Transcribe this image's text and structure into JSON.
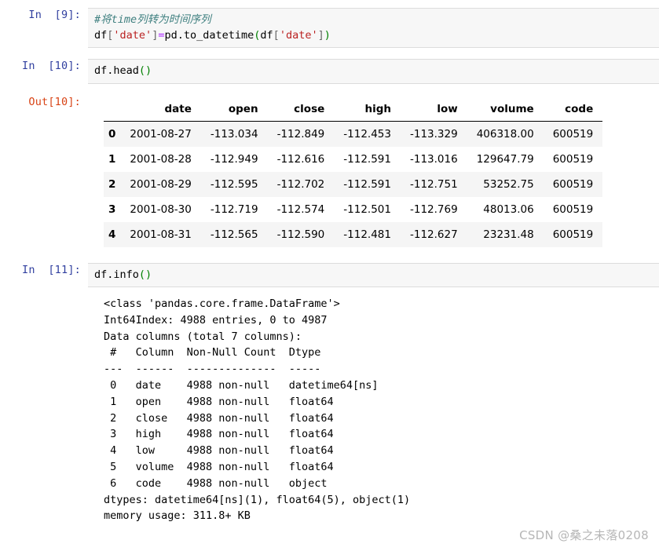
{
  "notebook": {
    "cells": [
      {
        "id": "cell-9",
        "prompt_in": "In  [9]:",
        "code_lines": [
          {
            "comment": "#将time列转为时间序列"
          },
          {
            "segments": [
              {
                "t": "plain",
                "v": "df"
              },
              {
                "t": "op",
                "v": "["
              },
              {
                "t": "str",
                "v": "'date'"
              },
              {
                "t": "op",
                "v": "]"
              },
              {
                "t": "eq",
                "v": "="
              },
              {
                "t": "plain",
                "v": "pd.to_datetime"
              },
              {
                "t": "paren",
                "v": "("
              },
              {
                "t": "plain",
                "v": "df"
              },
              {
                "t": "op",
                "v": "["
              },
              {
                "t": "str",
                "v": "'date'"
              },
              {
                "t": "op",
                "v": "]"
              },
              {
                "t": "paren",
                "v": ")"
              }
            ]
          }
        ]
      },
      {
        "id": "cell-10",
        "prompt_in": "In  [10]:",
        "prompt_out": "Out[10]:",
        "code_lines": [
          {
            "segments": [
              {
                "t": "plain",
                "v": "df.head"
              },
              {
                "t": "paren",
                "v": "()"
              }
            ]
          }
        ]
      },
      {
        "id": "cell-11",
        "prompt_in": "In  [11]:",
        "code_lines": [
          {
            "segments": [
              {
                "t": "plain",
                "v": "df.info"
              },
              {
                "t": "paren",
                "v": "()"
              }
            ]
          }
        ]
      }
    ]
  },
  "dataframe": {
    "index_header": "",
    "columns": [
      "date",
      "open",
      "close",
      "high",
      "low",
      "volume",
      "code"
    ],
    "index": [
      "0",
      "1",
      "2",
      "3",
      "4"
    ],
    "rows": [
      [
        "2001-08-27",
        "-113.034",
        "-112.849",
        "-112.453",
        "-113.329",
        "406318.00",
        "600519"
      ],
      [
        "2001-08-28",
        "-112.949",
        "-112.616",
        "-112.591",
        "-113.016",
        "129647.79",
        "600519"
      ],
      [
        "2001-08-29",
        "-112.595",
        "-112.702",
        "-112.591",
        "-112.751",
        "53252.75",
        "600519"
      ],
      [
        "2001-08-30",
        "-112.719",
        "-112.574",
        "-112.501",
        "-112.769",
        "48013.06",
        "600519"
      ],
      [
        "2001-08-31",
        "-112.565",
        "-112.590",
        "-112.481",
        "-112.627",
        "23231.48",
        "600519"
      ]
    ]
  },
  "info_output": {
    "text": "<class 'pandas.core.frame.DataFrame'>\nInt64Index: 4988 entries, 0 to 4987\nData columns (total 7 columns):\n #   Column  Non-Null Count  Dtype\n---  ------  --------------  -----\n 0   date    4988 non-null   datetime64[ns]\n 1   open    4988 non-null   float64\n 2   close   4988 non-null   float64\n 3   high    4988 non-null   float64\n 4   low     4988 non-null   float64\n 5   volume  4988 non-null   float64\n 6   code    4988 non-null   object\ndtypes: datetime64[ns](1), float64(5), object(1)\nmemory usage: 311.8+ KB"
  },
  "watermark": {
    "text": "CSDN @桑之未落0208"
  },
  "colors": {
    "prompt_in": "#303F9F",
    "prompt_out": "#D84315",
    "code_bg": "#f7f7f7",
    "code_border": "#dcdcdc",
    "comment": "#408080",
    "string": "#BA2121",
    "operator": "#AA22FF",
    "paren": "#008000",
    "row_stripe": "#f5f5f5",
    "watermark": "#b6b6b6"
  }
}
